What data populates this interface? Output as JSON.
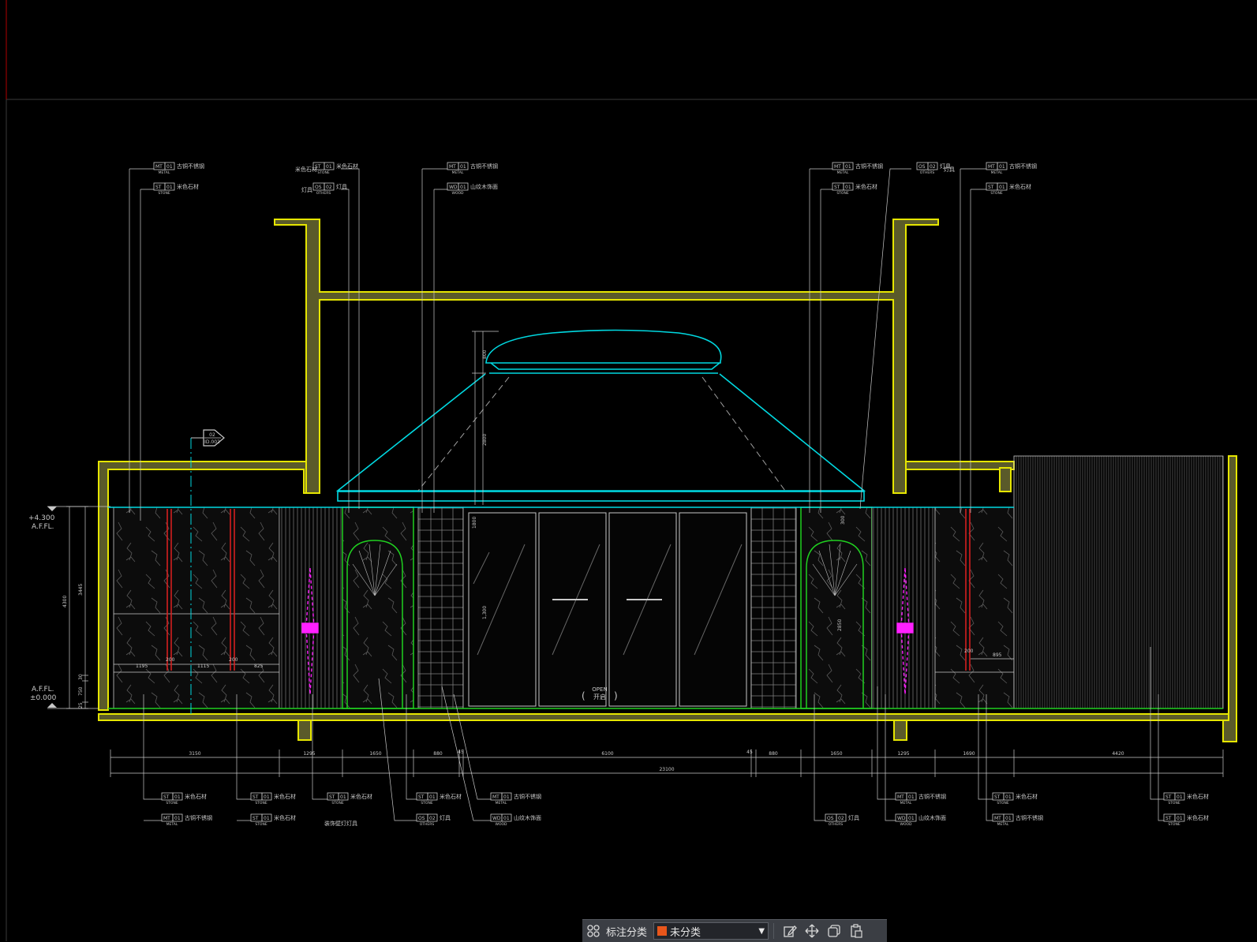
{
  "colors": {
    "background": "#000000",
    "wall": "#e6e600",
    "cyan": "#00d8e0",
    "green": "#20d020",
    "leader": "#c8c8c8",
    "red": "#e02020",
    "magenta": "#ff20ff",
    "toolbar_bg": "#3b3e44",
    "swatch": "#e8561b"
  },
  "levels": {
    "top_value": "+4.300",
    "top_label": "A.F.FL.",
    "bottom_label": "A.F.FL.",
    "bottom_value": "±0.000"
  },
  "vertical_dims": {
    "total": "4300",
    "upper": "3445",
    "mid": "30",
    "lower": "750",
    "base": "25"
  },
  "section_marker": {
    "top": "02",
    "bottom": "ID.002"
  },
  "door": {
    "open_en": "OPEN",
    "open_cn": "开启"
  },
  "canopy_dims": [
    "800",
    "2800"
  ],
  "inner_dims": [
    "1800",
    "1,300",
    "2850",
    "300"
  ],
  "sub_dims": [
    "1195",
    "200",
    "1115",
    "200",
    "825",
    "200",
    "895"
  ],
  "dims_bottom": [
    "3150",
    "1295",
    "1650",
    "880",
    "45",
    "6100",
    "45",
    "880",
    "1650",
    "1295",
    "1690",
    "4420"
  ],
  "dims_total": "23100",
  "callouts": {
    "mt01": {
      "code": "MT",
      "no": "01",
      "name": "古铜不锈钢",
      "cat": "METAL"
    },
    "st01": {
      "code": "ST",
      "no": "01",
      "name": "米色石材",
      "cat": "STONE"
    },
    "wd01": {
      "code": "WD",
      "no": "01",
      "name": "山纹木饰面",
      "cat": "WOOD"
    },
    "os02": {
      "code": "OS",
      "no": "02",
      "name": "灯具",
      "cat": "OTHERS"
    },
    "st01_left": {
      "name": "米色石材"
    },
    "os02_left": {
      "name": "灯具"
    },
    "os02_right": {
      "name": "灯具"
    },
    "lamp_note": "装饰壁灯灯具"
  },
  "toolbar": {
    "grid_icon": "grid-icon",
    "category_label": "标注分类",
    "category_value": "未分类",
    "edit_icon": "edit-icon",
    "move_icon": "move-icon",
    "copy_icon": "copy-icon",
    "paste_icon": "paste-icon"
  }
}
